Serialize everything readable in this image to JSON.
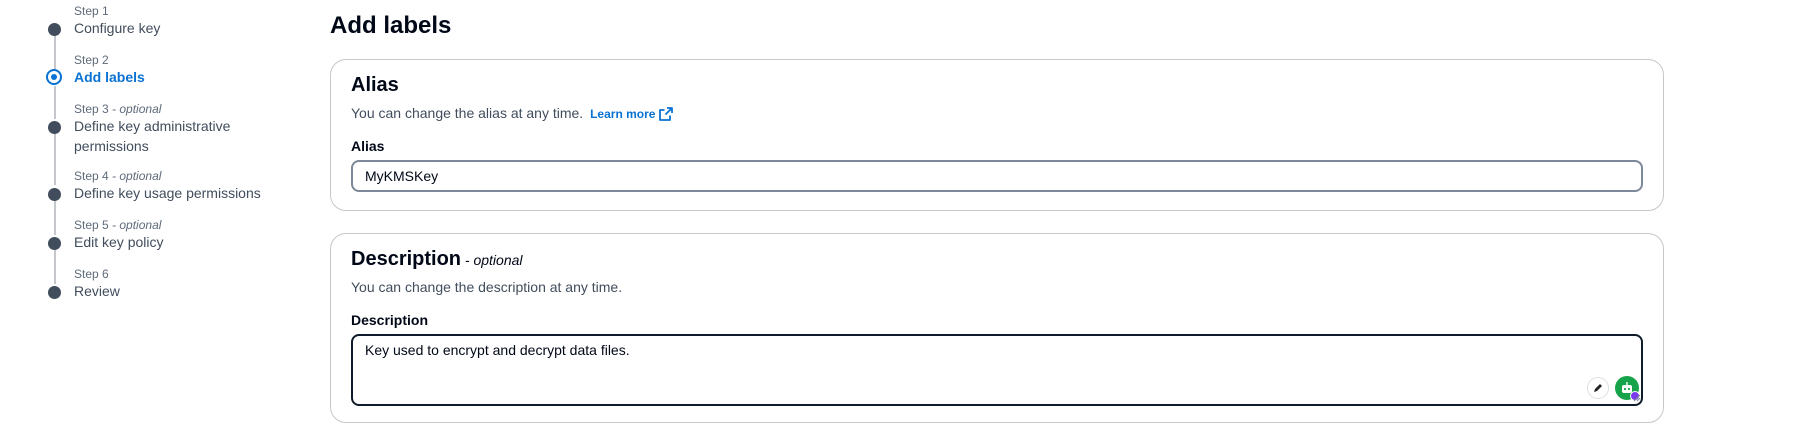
{
  "steps": [
    {
      "number": "Step 1",
      "optional": "",
      "title": "Configure key",
      "state": "done"
    },
    {
      "number": "Step 2",
      "optional": "",
      "title": "Add labels",
      "state": "active"
    },
    {
      "number": "Step 3",
      "optional": " - optional",
      "title": "Define key administrative permissions",
      "state": "todo"
    },
    {
      "number": "Step 4",
      "optional": " - optional",
      "title": "Define key usage permissions",
      "state": "todo"
    },
    {
      "number": "Step 5",
      "optional": " - optional",
      "title": "Edit key policy",
      "state": "todo"
    },
    {
      "number": "Step 6",
      "optional": "",
      "title": "Review",
      "state": "todo"
    }
  ],
  "page_title": "Add labels",
  "alias_card": {
    "title": "Alias",
    "description": "You can change the alias at any time.",
    "learn_more": "Learn more",
    "field_label": "Alias",
    "value": "MyKMSKey"
  },
  "description_card": {
    "title": "Description",
    "optional": " - optional",
    "description": "You can change the description at any time.",
    "field_label": "Description",
    "value": "Key used to encrypt and decrypt data files."
  },
  "icons": {
    "external_link": "external-link-icon",
    "pen": "pen-icon",
    "assistant": "assistant-bot-icon"
  },
  "colors": {
    "accent": "#0972d3",
    "text": "#000716",
    "muted": "#414d5c",
    "border": "#c6c6cd"
  }
}
